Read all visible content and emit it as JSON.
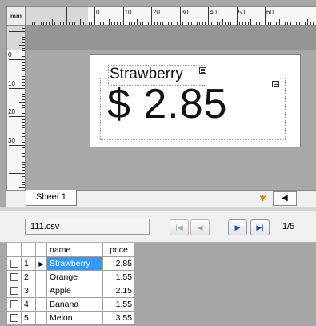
{
  "ruler": {
    "unit": "mm",
    "h_labels": [
      "0",
      "10",
      "20",
      "30",
      "40",
      "50",
      "60"
    ],
    "v_labels": [
      "0",
      "10",
      "20",
      "30"
    ]
  },
  "label": {
    "product": "Strawberry",
    "price": "$ 2.85"
  },
  "sheet": {
    "tab_label": "Sheet 1"
  },
  "database": {
    "file_name": "111.csv",
    "page_indicator": "1/5",
    "columns": [
      "name",
      "price"
    ],
    "rows": [
      {
        "num": "1",
        "name": "Strawberry",
        "price": "2.85",
        "current": true
      },
      {
        "num": "2",
        "name": "Orange",
        "price": "1.55",
        "current": false
      },
      {
        "num": "3",
        "name": "Apple",
        "price": "2.15",
        "current": false
      },
      {
        "num": "4",
        "name": "Banana",
        "price": "1.55",
        "current": false
      },
      {
        "num": "5",
        "name": "Melon",
        "price": "3.55",
        "current": false
      }
    ]
  },
  "colors": {
    "selection": "#3399ff",
    "nav_enabled": "#1a47c8"
  }
}
